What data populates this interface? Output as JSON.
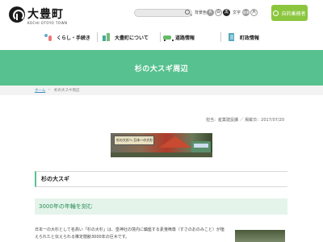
{
  "header": {
    "logo_name": "大豊町",
    "logo_sub": "KOCHI OTOYO TOWN",
    "search": {
      "placeholder": ""
    },
    "bg_label": "背景色",
    "bg_options": [
      "青",
      "白",
      "黒"
    ],
    "font_label": "文字",
    "font_options": [
      "標準",
      "大"
    ],
    "faq_button": "自的乗務者"
  },
  "nav": {
    "items": [
      {
        "label": "くらし・手続き",
        "icon": "people-icon"
      },
      {
        "label": "大豊町について",
        "icon": "city-icon"
      },
      {
        "label": "道路情報",
        "icon": "car-icon"
      },
      {
        "label": "町政情報",
        "icon": "document-icon"
      }
    ]
  },
  "banner": {
    "title": "杉の大スギ周辺"
  },
  "breadcrumb": {
    "home": "ホーム",
    "separator": "›",
    "current": "杉の大スギ周辺"
  },
  "meta": {
    "text": "担当：産業建設課 ／ 掲載日：2017/07/20"
  },
  "hero": {
    "sign_text": "杉の大杉へ  日本一の大杉"
  },
  "section": {
    "title": "杉の大スギ"
  },
  "subhead": {
    "title": "3000年の年輪を刻む"
  },
  "body": {
    "paragraph": "日本一の大杉として名高い「杉の大杉」は、皇神社の境内に鎮座する素戔嗚尊（すさのおのみこと）が植えられたと伝えられる推定樹齢3000年の巨木です。"
  },
  "colors": {
    "accent": "#57c18f",
    "button": "#8cc63e",
    "subhead_bg": "#e4f4ea",
    "link": "#3b8dbd"
  }
}
